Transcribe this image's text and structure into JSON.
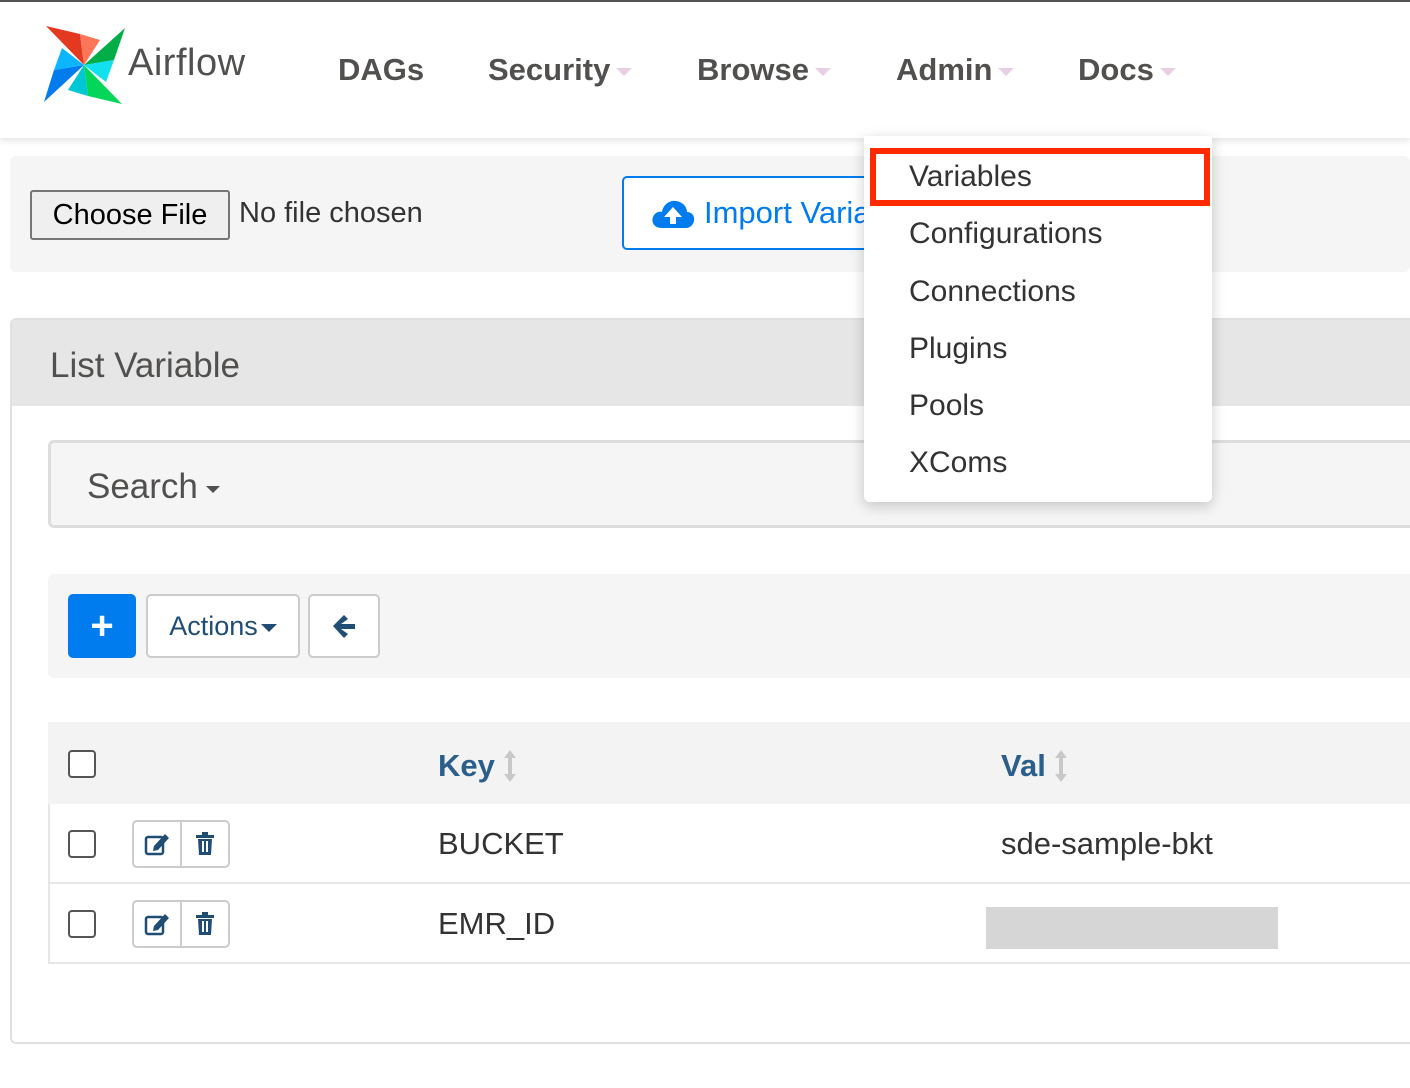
{
  "brand": {
    "name": "Airflow"
  },
  "nav": {
    "dags": "DAGs",
    "security": "Security",
    "browse": "Browse",
    "admin": "Admin",
    "docs": "Docs"
  },
  "admin_menu": {
    "items": [
      "Variables",
      "Configurations",
      "Connections",
      "Plugins",
      "Pools",
      "XComs"
    ],
    "highlighted": "Variables",
    "highlight_color": "#ff2a00"
  },
  "import": {
    "choose_file_label": "Choose File",
    "no_file_text": "No file chosen",
    "import_button_label": "Import Variables"
  },
  "panel": {
    "title": "List Variable"
  },
  "search": {
    "label": "Search"
  },
  "toolbar": {
    "add_label": "+",
    "actions_label": "Actions"
  },
  "table": {
    "columns": {
      "key": "Key",
      "val": "Val"
    },
    "rows": [
      {
        "key": "BUCKET",
        "val": "sde-sample-bkt",
        "val_redacted": false
      },
      {
        "key": "EMR_ID",
        "val": "",
        "val_redacted": true
      }
    ]
  },
  "colors": {
    "accent": "#017cee",
    "header_text": "#2c5e8a",
    "nav_text": "#51504f"
  },
  "icons": [
    "airflow-logo-icon",
    "cloud-upload-icon",
    "arrow-left-icon",
    "edit-icon",
    "trash-icon",
    "sort-icon"
  ]
}
